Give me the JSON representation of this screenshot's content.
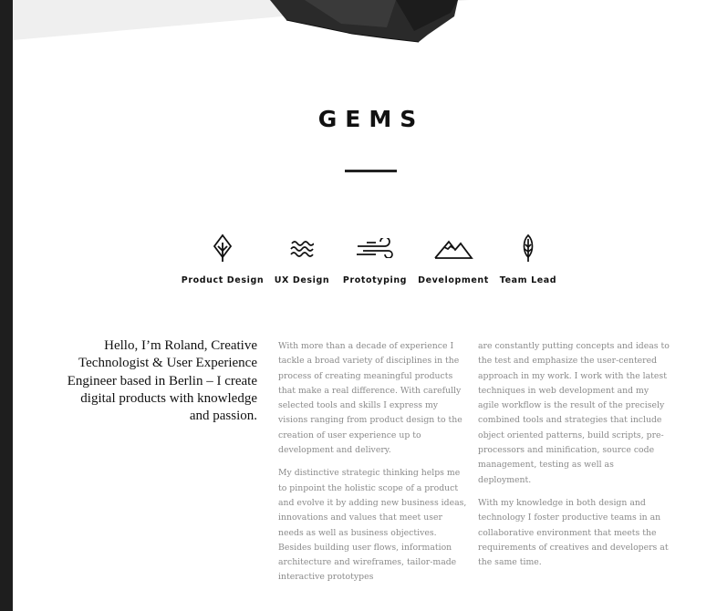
{
  "section": {
    "title": "GEMS"
  },
  "skills": [
    {
      "label": "Product Design",
      "icon": "tree-icon"
    },
    {
      "label": "UX Design",
      "icon": "waves-icon"
    },
    {
      "label": "Prototyping",
      "icon": "wind-icon"
    },
    {
      "label": "Development",
      "icon": "mountain-icon"
    },
    {
      "label": "Team Lead",
      "icon": "feather-icon"
    }
  ],
  "intro": "Hello, I’m Roland, Creative Technologist & User Experience Engineer based in Berlin – I create digital products with knowledge and passion.",
  "columns": [
    [
      "With more than a decade of experience I tackle a broad variety of disciplines in the process of creating meaningful products that make a real difference. With carefully selected tools and skills I express my visions ranging from product design to the creation of user experience up to development and delivery.",
      "My distinctive strategic thinking helps me to pinpoint the holistic scope of a product and evolve it by adding new business ideas, innovations and values that meet user needs as well as business objectives. Besides building user flows, information architecture and wireframes, tailor-made interactive prototypes"
    ],
    [
      "are constantly putting concepts and ideas to the test and emphasize the user-centered approach in my work. I work with the latest techniques in web development and my agile workflow is the result of the precisely combined tools and strategies that include object oriented patterns, build scripts, pre-processors and minification, source code management, testing as well as deployment.",
      "With my knowledge in both design and technology I foster productive teams in an collaborative environment that meets the requirements of creatives and developers at the same time."
    ]
  ],
  "colors": {
    "text": "#111111",
    "body_text": "#8a8a8a",
    "rail": "#1e1e1e"
  }
}
